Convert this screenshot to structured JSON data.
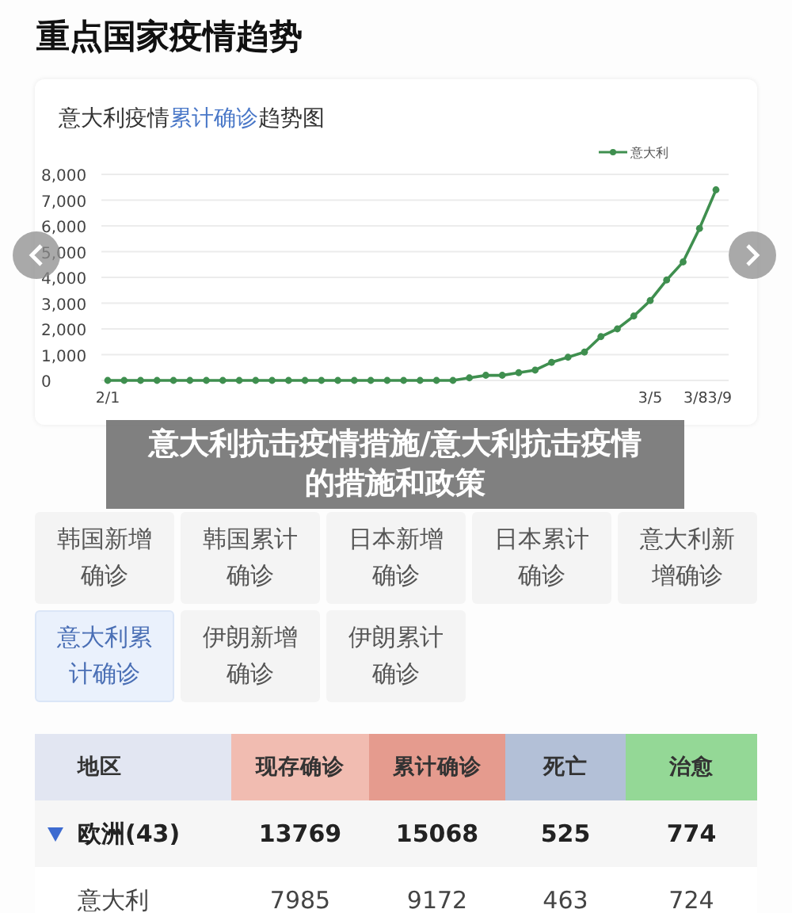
{
  "page_title": "重点国家疫情趋势",
  "chart_card": {
    "title": {
      "before": "意大利疫情",
      "highlight": "累计确诊",
      "after": "趋势图"
    },
    "chart_data": {
      "type": "line",
      "grid": true,
      "categories": [
        "2/1",
        null,
        null,
        null,
        null,
        null,
        null,
        null,
        null,
        null,
        null,
        null,
        null,
        null,
        null,
        null,
        null,
        null,
        null,
        null,
        null,
        null,
        null,
        null,
        null,
        null,
        null,
        null,
        null,
        null,
        null,
        null,
        null,
        "3/5",
        null,
        null,
        "3/8",
        "3/9"
      ],
      "series": [
        {
          "name": "意大利",
          "color": "#3f8f4f",
          "marker": "circle",
          "values": [
            0,
            0,
            0,
            0,
            0,
            0,
            0,
            0,
            0,
            0,
            0,
            0,
            0,
            0,
            0,
            0,
            0,
            0,
            0,
            0,
            0,
            0,
            100,
            200,
            200,
            300,
            400,
            700,
            900,
            1100,
            1700,
            2000,
            2500,
            3100,
            3900,
            4600,
            5900,
            7400
          ]
        }
      ],
      "ylim": [
        0,
        8000
      ],
      "yticks": [
        {
          "value": 0,
          "label": "0"
        },
        {
          "value": 1000,
          "label": "1,000"
        },
        {
          "value": 2000,
          "label": "2,000"
        },
        {
          "value": 3000,
          "label": "3,000"
        },
        {
          "value": 4000,
          "label": "4,000"
        },
        {
          "value": 5000,
          "label": "5,000"
        },
        {
          "value": 6000,
          "label": "6,000"
        },
        {
          "value": 7000,
          "label": "7,000"
        },
        {
          "value": 8000,
          "label": "8,000"
        }
      ]
    }
  },
  "banner": "意大利抗击疫情措施/意大利抗击疫情的措施和政策",
  "tabs": [
    {
      "label": "韩国新增确诊",
      "selected": false
    },
    {
      "label": "韩国累计确诊",
      "selected": false
    },
    {
      "label": "日本新增确诊",
      "selected": false
    },
    {
      "label": "日本累计确诊",
      "selected": false
    },
    {
      "label": "意大利新增确诊",
      "selected": false
    },
    {
      "label": "意大利累计确诊",
      "selected": true
    },
    {
      "label": "伊朗新增确诊",
      "selected": false
    },
    {
      "label": "伊朗累计确诊",
      "selected": false
    }
  ],
  "table": {
    "columns": [
      {
        "label": "地区",
        "color": "#e2e6f2"
      },
      {
        "label": "现存确诊",
        "color": "#f1bcb1"
      },
      {
        "label": "累计确诊",
        "color": "#e59b8e"
      },
      {
        "label": "死亡",
        "color": "#b3c0d7"
      },
      {
        "label": "治愈",
        "color": "#94d896"
      }
    ],
    "rows": [
      {
        "kind": "group",
        "expanded": true,
        "cells": [
          "欧洲(43)",
          "13769",
          "15068",
          "525",
          "774"
        ]
      },
      {
        "kind": "item",
        "cells": [
          "意大利",
          "7985",
          "9172",
          "463",
          "724"
        ]
      }
    ]
  }
}
